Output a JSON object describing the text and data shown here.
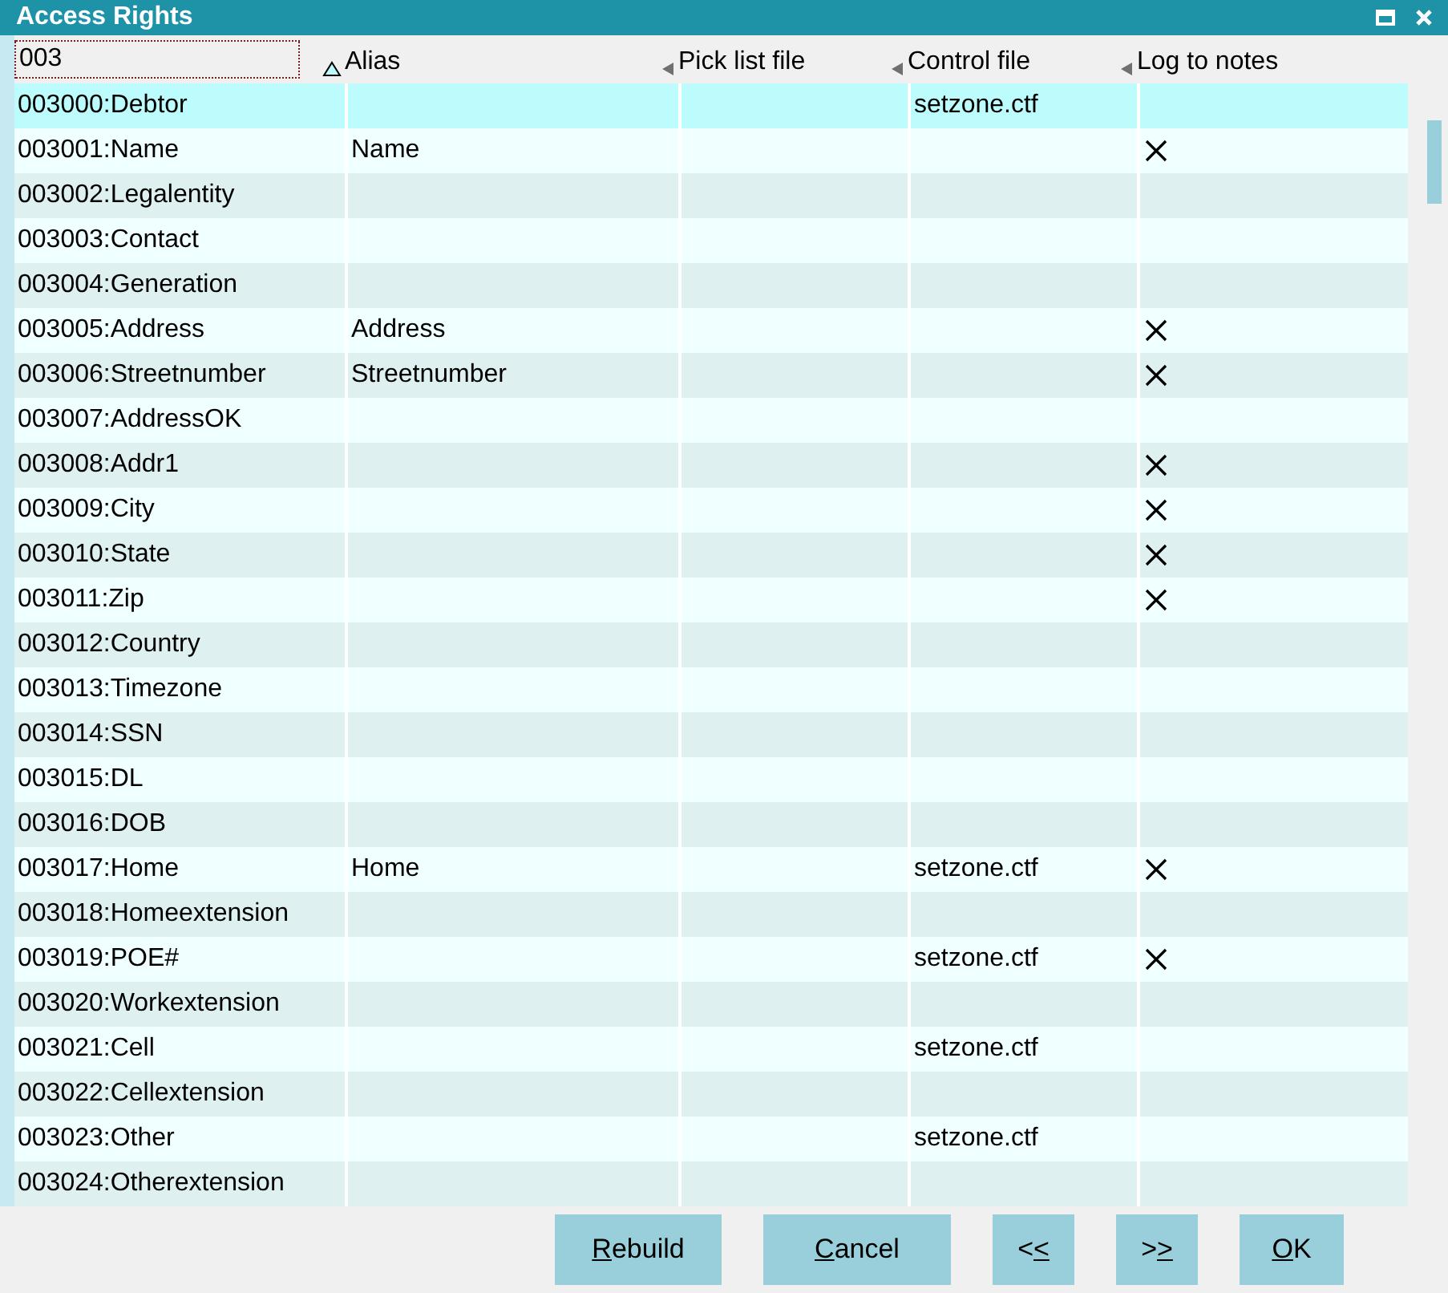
{
  "window": {
    "title": "Access Rights"
  },
  "filter": {
    "value": "003"
  },
  "columns": [
    {
      "label": "Alias"
    },
    {
      "label": "Pick list file"
    },
    {
      "label": "Control file"
    },
    {
      "label": "Log to notes"
    }
  ],
  "rows": [
    {
      "field": "003000:Debtor",
      "control": "setzone.ctf",
      "log": false,
      "selected": true
    },
    {
      "field": "003001:Name",
      "alias": "Name",
      "log": true,
      "selected": false
    },
    {
      "field": "003002:Legalentity",
      "log": false,
      "selected": false
    },
    {
      "field": "003003:Contact",
      "log": false,
      "selected": false
    },
    {
      "field": "003004:Generation",
      "log": false,
      "selected": false
    },
    {
      "field": "003005:Address",
      "alias": "Address",
      "log": true,
      "selected": false
    },
    {
      "field": "003006:Streetnumber",
      "alias": "Streetnumber",
      "log": true,
      "selected": false
    },
    {
      "field": "003007:AddressOK",
      "log": false,
      "selected": false
    },
    {
      "field": "003008:Addr1",
      "log": true,
      "selected": false
    },
    {
      "field": "003009:City",
      "log": true,
      "selected": false
    },
    {
      "field": "003010:State",
      "log": true,
      "selected": false
    },
    {
      "field": "003011:Zip",
      "log": true,
      "selected": false
    },
    {
      "field": "003012:Country",
      "log": false,
      "selected": false
    },
    {
      "field": "003013:Timezone",
      "log": false,
      "selected": false
    },
    {
      "field": "003014:SSN",
      "log": false,
      "selected": false
    },
    {
      "field": "003015:DL",
      "log": false,
      "selected": false
    },
    {
      "field": "003016:DOB",
      "log": false,
      "selected": false
    },
    {
      "field": "003017:Home",
      "alias": "Home",
      "control": "setzone.ctf",
      "log": true,
      "selected": false
    },
    {
      "field": "003018:Homeextension",
      "log": false,
      "selected": false
    },
    {
      "field": "003019:POE#",
      "control": "setzone.ctf",
      "log": true,
      "selected": false
    },
    {
      "field": "003020:Workextension",
      "log": false,
      "selected": false
    },
    {
      "field": "003021:Cell",
      "control": "setzone.ctf",
      "log": false,
      "selected": false
    },
    {
      "field": "003022:Cellextension",
      "log": false,
      "selected": false
    },
    {
      "field": "003023:Other",
      "control": "setzone.ctf",
      "log": false,
      "selected": false
    },
    {
      "field": "003024:Otherextension",
      "log": false,
      "selected": false
    }
  ],
  "buttons": [
    {
      "key": "R",
      "after": "ebuild"
    },
    {
      "key": "C",
      "after": "ancel"
    },
    {
      "before": "<",
      "key": "<"
    },
    {
      "before": ">",
      "key": ">"
    },
    {
      "key": "O",
      "after": "K"
    }
  ]
}
